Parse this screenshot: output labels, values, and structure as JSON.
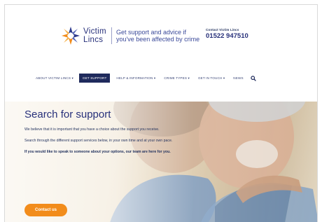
{
  "header": {
    "brand_name_line1": "Victim",
    "brand_name_line2": "Lincs",
    "tagline": "Get support and advice if you've been affected by crime",
    "contact_label": "Contact Victim Lincs",
    "contact_phone": "01522 947510"
  },
  "nav": {
    "items": [
      {
        "label": "ABOUT VICTIM LINCS ▾"
      },
      {
        "label": "GET SUPPORT"
      },
      {
        "label": "HELP & INFORMATION ▾"
      },
      {
        "label": "CRIME TYPES ▾"
      },
      {
        "label": "GET IN TOUCH ▾"
      },
      {
        "label": "NEWS"
      }
    ],
    "search_icon": "search-icon"
  },
  "hero": {
    "title": "Search for support",
    "p1": "We believe that it is important that you have a choice about the support you receive.",
    "p2": "Search through the different support services below, in your own time and at your own pace.",
    "p3": "If you would like to speak to someone about your options, our team are here for you.",
    "cta_label": "Contact us"
  },
  "colors": {
    "brand_navy": "#27307a",
    "active_nav": "#1f2a5c",
    "cta_orange": "#f28c1b"
  }
}
